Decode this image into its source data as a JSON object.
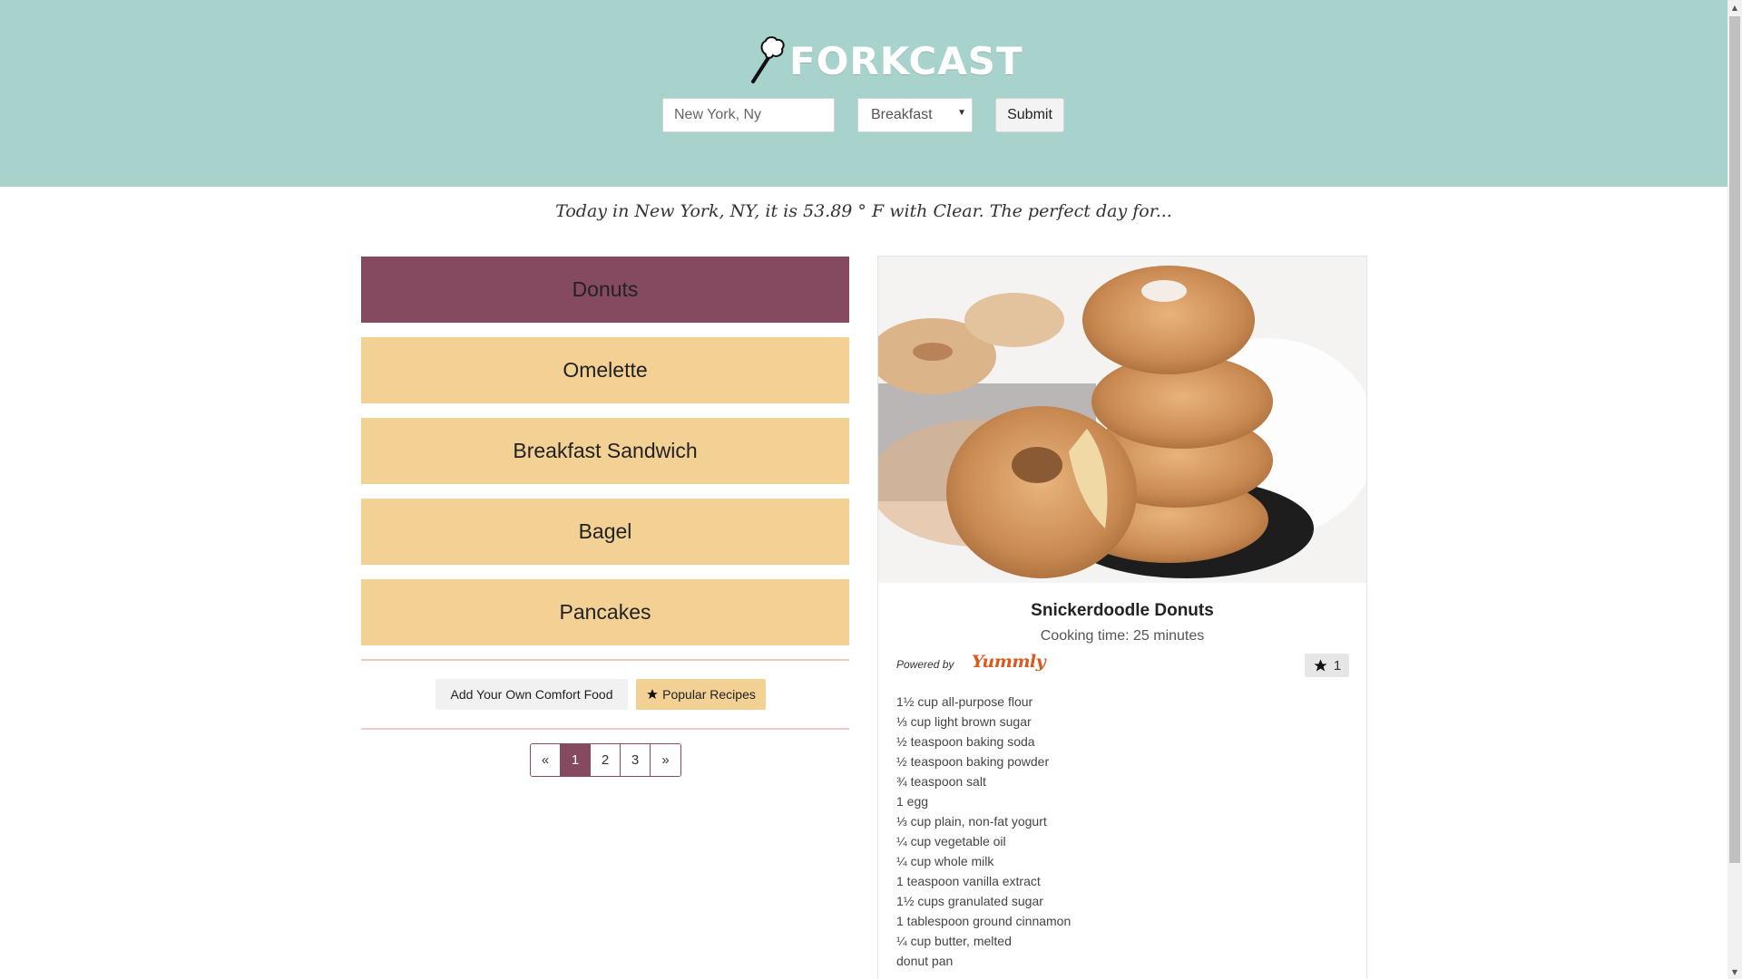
{
  "header": {
    "logo_text": "FORKCAST",
    "location_input_value": "New York, Ny",
    "meal_select_value": "Breakfast",
    "submit_label": "Submit",
    "background_color": "#a8d3cd"
  },
  "tagline": "Today in New York, NY, it is 53.89 ° F with Clear. The perfect day for...",
  "foods": [
    {
      "label": "Donuts",
      "active": true
    },
    {
      "label": "Omelette",
      "active": false
    },
    {
      "label": "Breakfast Sandwich",
      "active": false
    },
    {
      "label": "Bagel",
      "active": false
    },
    {
      "label": "Pancakes",
      "active": false
    }
  ],
  "actions": {
    "add_label": "Add Your Own Comfort Food",
    "popular_label": "Popular Recipes"
  },
  "pagination": {
    "prev": "«",
    "pages": [
      "1",
      "2",
      "3"
    ],
    "current": "1",
    "next": "»"
  },
  "recipe": {
    "title": "Snickerdoodle Donuts",
    "cooking_time": "Cooking time: 25 minutes",
    "powered_by": "Powered by",
    "yummly_logo": "Yummly",
    "star_count": "1",
    "ingredients": [
      "1½ cup all-purpose flour",
      "⅓ cup light brown sugar",
      "½ teaspoon baking soda",
      "½ teaspoon baking powder",
      "¾ teaspoon salt",
      "1 egg",
      "⅓ cup plain, non-fat yogurt",
      "¼ cup vegetable oil",
      "¼ cup whole milk",
      "1 teaspoon vanilla extract",
      "1½ cups granulated sugar",
      "1 tablespoon ground cinnamon",
      "¼ cup butter, melted",
      "donut pan"
    ]
  },
  "colors": {
    "accent": "#864a60",
    "food_button": "#f3d194",
    "header": "#a8d3cd",
    "yummly": "#d9591f"
  }
}
